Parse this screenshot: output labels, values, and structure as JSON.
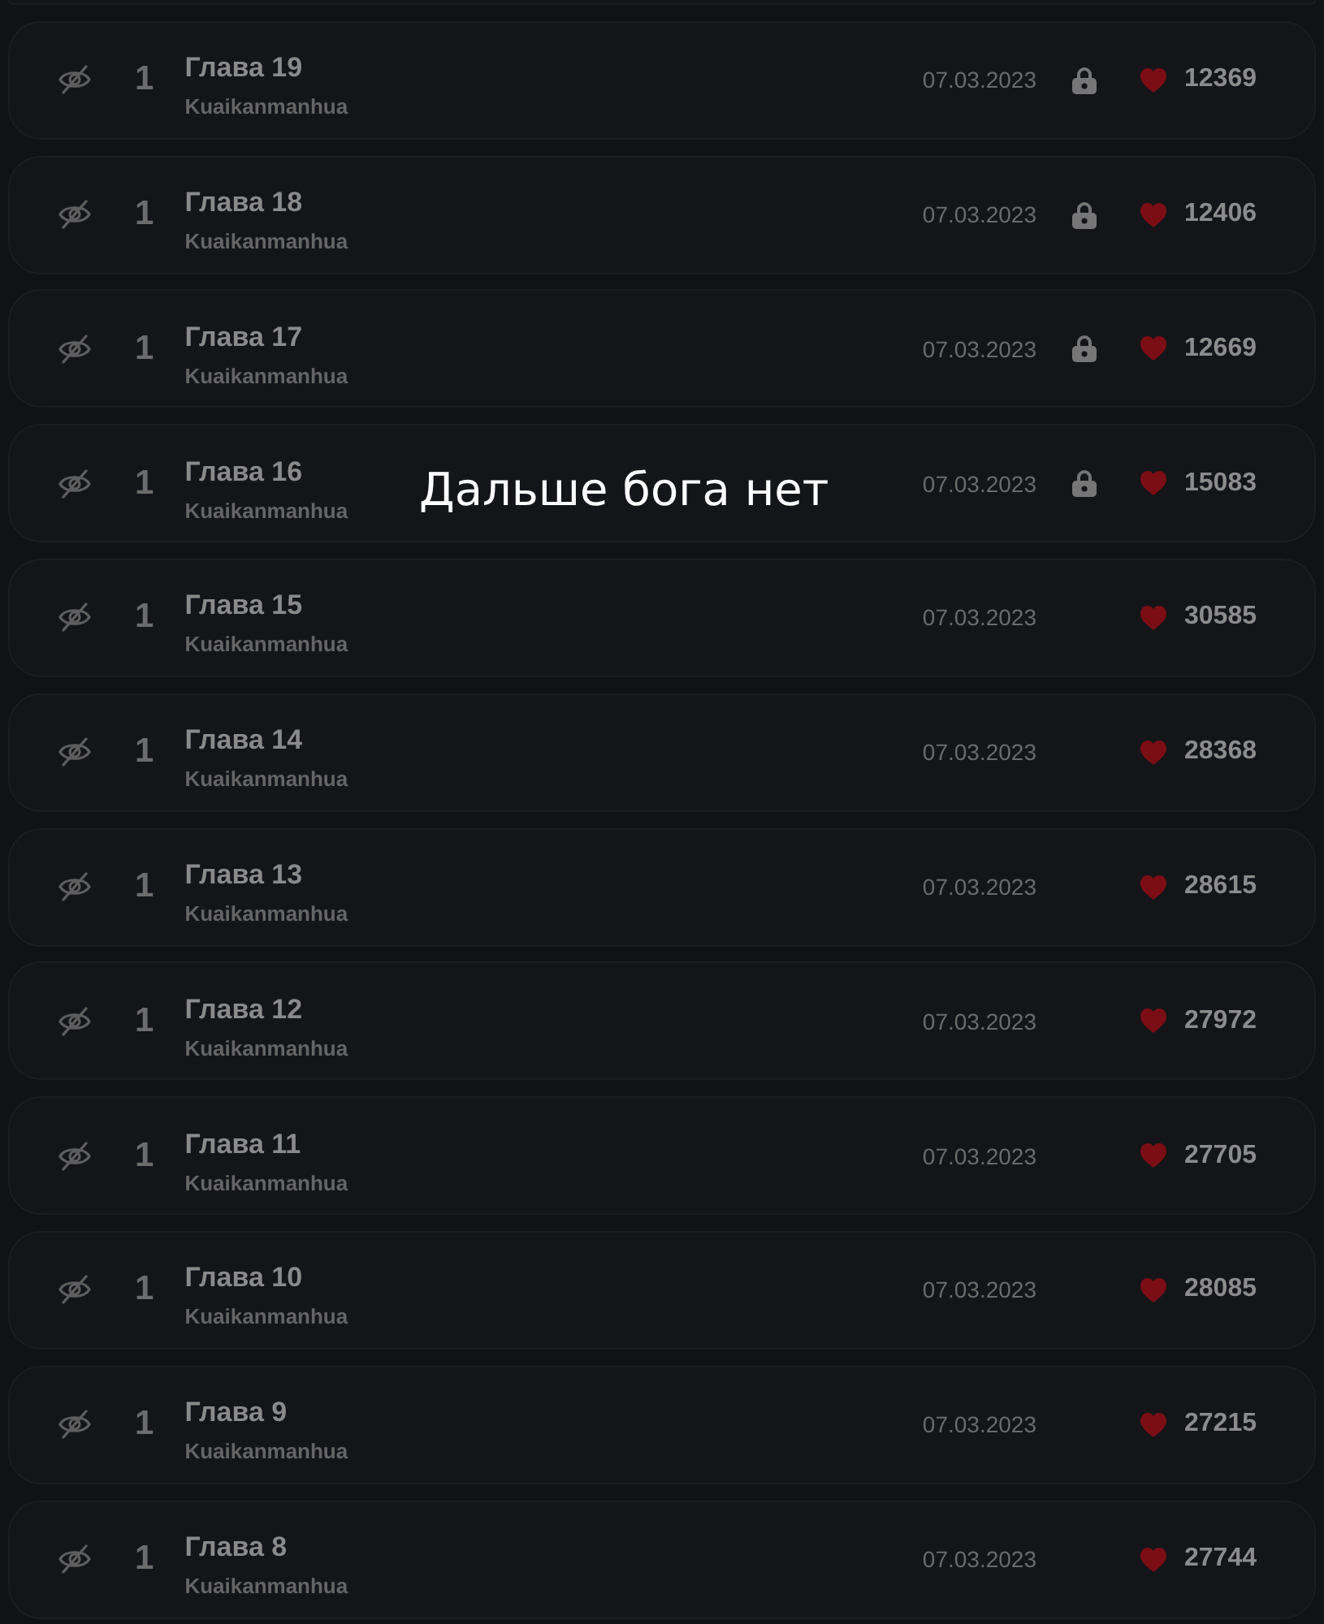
{
  "caption": "Дальше бога нет",
  "chapters": [
    {
      "viewed": false,
      "number": "1",
      "title": "Глава 19",
      "source": "Kuaikanmanhua",
      "date": "07.03.2023",
      "locked": true,
      "likes": "12369"
    },
    {
      "viewed": false,
      "number": "1",
      "title": "Глава 18",
      "source": "Kuaikanmanhua",
      "date": "07.03.2023",
      "locked": true,
      "likes": "12406"
    },
    {
      "viewed": false,
      "number": "1",
      "title": "Глава 17",
      "source": "Kuaikanmanhua",
      "date": "07.03.2023",
      "locked": true,
      "likes": "12669"
    },
    {
      "viewed": false,
      "number": "1",
      "title": "Глава 16",
      "source": "Kuaikanmanhua",
      "date": "07.03.2023",
      "locked": true,
      "likes": "15083"
    },
    {
      "viewed": false,
      "number": "1",
      "title": "Глава 15",
      "source": "Kuaikanmanhua",
      "date": "07.03.2023",
      "locked": false,
      "likes": "30585"
    },
    {
      "viewed": false,
      "number": "1",
      "title": "Глава 14",
      "source": "Kuaikanmanhua",
      "date": "07.03.2023",
      "locked": false,
      "likes": "28368"
    },
    {
      "viewed": false,
      "number": "1",
      "title": "Глава 13",
      "source": "Kuaikanmanhua",
      "date": "07.03.2023",
      "locked": false,
      "likes": "28615"
    },
    {
      "viewed": false,
      "number": "1",
      "title": "Глава 12",
      "source": "Kuaikanmanhua",
      "date": "07.03.2023",
      "locked": false,
      "likes": "27972"
    },
    {
      "viewed": false,
      "number": "1",
      "title": "Глава 11",
      "source": "Kuaikanmanhua",
      "date": "07.03.2023",
      "locked": false,
      "likes": "27705"
    },
    {
      "viewed": false,
      "number": "1",
      "title": "Глава 10",
      "source": "Kuaikanmanhua",
      "date": "07.03.2023",
      "locked": false,
      "likes": "28085"
    },
    {
      "viewed": false,
      "number": "1",
      "title": "Глава 9",
      "source": "Kuaikanmanhua",
      "date": "07.03.2023",
      "locked": false,
      "likes": "27215"
    },
    {
      "viewed": false,
      "number": "1",
      "title": "Глава 8",
      "source": "Kuaikanmanhua",
      "date": "07.03.2023",
      "locked": false,
      "likes": "27744"
    }
  ]
}
